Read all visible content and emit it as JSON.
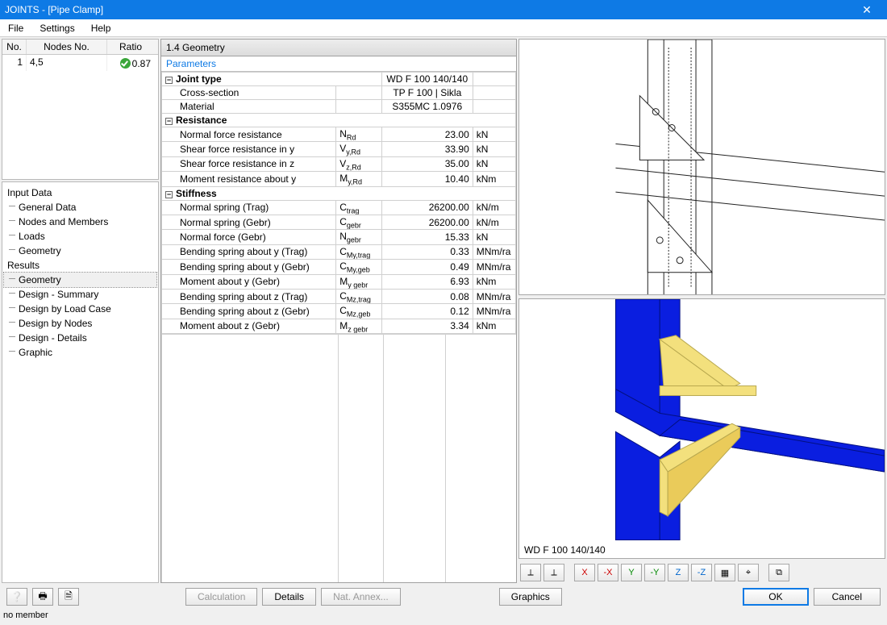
{
  "title": "JOINTS - [Pipe Clamp]",
  "menu": {
    "file": "File",
    "settings": "Settings",
    "help": "Help"
  },
  "nodeTable": {
    "headers": {
      "no": "No.",
      "nodes": "Nodes No.",
      "ratio": "Ratio"
    },
    "row": {
      "no": "1",
      "nodes": "4,5",
      "ratio": "0.87"
    }
  },
  "tree": {
    "inputData": "Input Data",
    "generalData": "General Data",
    "nodesMembers": "Nodes and Members",
    "loads": "Loads",
    "geometry": "Geometry",
    "results": "Results",
    "rGeometry": "Geometry",
    "rSummary": "Design - Summary",
    "rByLoadCase": "Design by Load Case",
    "rByNodes": "Design by Nodes",
    "rDetails": "Design - Details",
    "rGraphic": "Graphic"
  },
  "midTitle": "1.4 Geometry",
  "paramsHeader": "Parameters",
  "groups": {
    "jointType": "Joint type",
    "resistance": "Resistance",
    "stiffness": "Stiffness"
  },
  "jt": {
    "val": "WD F 100 140/140",
    "crossSection_l": "Cross-section",
    "crossSection_v": "TP F 100 | Sikla",
    "material_l": "Material",
    "material_v": "S355MC 1.0976"
  },
  "res": {
    "nrd_l": "Normal force resistance",
    "nrd_s": "Rd",
    "nrd_v": "23.00",
    "nrd_u": "kN",
    "vy_l": "Shear force resistance in y",
    "vy_s": "y,Rd",
    "vy_v": "33.90",
    "vy_u": "kN",
    "vz_l": "Shear force resistance in z",
    "vz_s": "z,Rd",
    "vz_v": "35.00",
    "vz_u": "kN",
    "my_l": "Moment resistance about y",
    "my_s": "y,Rd",
    "my_v": "10.40",
    "my_u": "kNm"
  },
  "stf": {
    "r1_l": "Normal spring (Trag)",
    "r1_s": "trag",
    "r1_v": "26200.00",
    "r1_u": "kN/m",
    "r2_l": "Normal spring (Gebr)",
    "r2_s": "gebr",
    "r2_v": "26200.00",
    "r2_u": "kN/m",
    "r3_l": "Normal force (Gebr)",
    "r3_s": "gebr",
    "r3_v": "15.33",
    "r3_u": "kN",
    "r4_l": "Bending spring about y (Trag)",
    "r4_s": "My,trag",
    "r4_v": "0.33",
    "r4_u": "MNm/ra",
    "r5_l": "Bending spring about y (Gebr)",
    "r5_s": "My,geb",
    "r5_v": "0.49",
    "r5_u": "MNm/ra",
    "r6_l": "Moment about y (Gebr)",
    "r6_s": "y gebr",
    "r6_v": "6.93",
    "r6_u": "kNm",
    "r7_l": "Bending spring about z (Trag)",
    "r7_s": "Mz,trag",
    "r7_v": "0.08",
    "r7_u": "MNm/ra",
    "r8_l": "Bending spring about z (Gebr)",
    "r8_s": "Mz,geb",
    "r8_v": "0.12",
    "r8_u": "MNm/ra",
    "r9_l": "Moment about z (Gebr)",
    "r9_s": "z gebr",
    "r9_v": "3.34",
    "r9_u": "kNm"
  },
  "bottomImageLabel": "WD F 100 140/140",
  "buttons": {
    "calculation": "Calculation",
    "details": "Details",
    "natAnnex": "Nat. Annex...",
    "graphics": "Graphics",
    "ok": "OK",
    "cancel": "Cancel"
  },
  "status": "no member",
  "viewIcons": [
    "⟂",
    "⟂",
    "X",
    "-X",
    "Y",
    "-Y",
    "Z",
    "-Z",
    "▦",
    "⌖",
    "⧉"
  ]
}
